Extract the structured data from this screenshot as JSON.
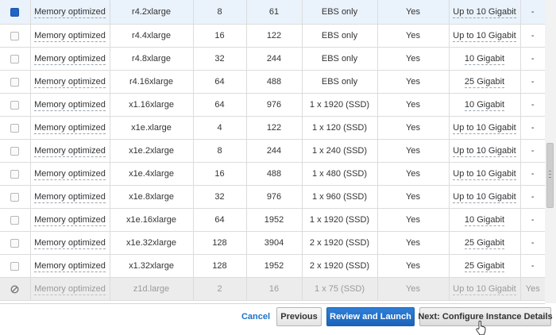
{
  "instance_table": {
    "rows": [
      {
        "state": "checked",
        "family": "Memory optimized",
        "type": "r4.2xlarge",
        "vcpus": "8",
        "memory": "61",
        "storage": "EBS only",
        "ebs_optimized": "Yes",
        "network": "Up to 10 Gigabit",
        "ipv6": "-"
      },
      {
        "state": "unchecked",
        "family": "Memory optimized",
        "type": "r4.4xlarge",
        "vcpus": "16",
        "memory": "122",
        "storage": "EBS only",
        "ebs_optimized": "Yes",
        "network": "Up to 10 Gigabit",
        "ipv6": "-"
      },
      {
        "state": "unchecked",
        "family": "Memory optimized",
        "type": "r4.8xlarge",
        "vcpus": "32",
        "memory": "244",
        "storage": "EBS only",
        "ebs_optimized": "Yes",
        "network": "10 Gigabit",
        "ipv6": "-"
      },
      {
        "state": "unchecked",
        "family": "Memory optimized",
        "type": "r4.16xlarge",
        "vcpus": "64",
        "memory": "488",
        "storage": "EBS only",
        "ebs_optimized": "Yes",
        "network": "25 Gigabit",
        "ipv6": "-"
      },
      {
        "state": "unchecked",
        "family": "Memory optimized",
        "type": "x1.16xlarge",
        "vcpus": "64",
        "memory": "976",
        "storage": "1 x 1920 (SSD)",
        "ebs_optimized": "Yes",
        "network": "10 Gigabit",
        "ipv6": "-"
      },
      {
        "state": "unchecked",
        "family": "Memory optimized",
        "type": "x1e.xlarge",
        "vcpus": "4",
        "memory": "122",
        "storage": "1 x 120 (SSD)",
        "ebs_optimized": "Yes",
        "network": "Up to 10 Gigabit",
        "ipv6": "-"
      },
      {
        "state": "unchecked",
        "family": "Memory optimized",
        "type": "x1e.2xlarge",
        "vcpus": "8",
        "memory": "244",
        "storage": "1 x 240 (SSD)",
        "ebs_optimized": "Yes",
        "network": "Up to 10 Gigabit",
        "ipv6": "-"
      },
      {
        "state": "unchecked",
        "family": "Memory optimized",
        "type": "x1e.4xlarge",
        "vcpus": "16",
        "memory": "488",
        "storage": "1 x 480 (SSD)",
        "ebs_optimized": "Yes",
        "network": "Up to 10 Gigabit",
        "ipv6": "-"
      },
      {
        "state": "unchecked",
        "family": "Memory optimized",
        "type": "x1e.8xlarge",
        "vcpus": "32",
        "memory": "976",
        "storage": "1 x 960 (SSD)",
        "ebs_optimized": "Yes",
        "network": "Up to 10 Gigabit",
        "ipv6": "-"
      },
      {
        "state": "unchecked",
        "family": "Memory optimized",
        "type": "x1e.16xlarge",
        "vcpus": "64",
        "memory": "1952",
        "storage": "1 x 1920 (SSD)",
        "ebs_optimized": "Yes",
        "network": "10 Gigabit",
        "ipv6": "-"
      },
      {
        "state": "unchecked",
        "family": "Memory optimized",
        "type": "x1e.32xlarge",
        "vcpus": "128",
        "memory": "3904",
        "storage": "2 x 1920 (SSD)",
        "ebs_optimized": "Yes",
        "network": "25 Gigabit",
        "ipv6": "-"
      },
      {
        "state": "unchecked",
        "family": "Memory optimized",
        "type": "x1.32xlarge",
        "vcpus": "128",
        "memory": "1952",
        "storage": "2 x 1920 (SSD)",
        "ebs_optimized": "Yes",
        "network": "25 Gigabit",
        "ipv6": "-"
      },
      {
        "state": "unavailable",
        "family": "Memory optimized",
        "type": "z1d.large",
        "vcpus": "2",
        "memory": "16",
        "storage": "1 x 75 (SSD)",
        "ebs_optimized": "Yes",
        "network": "Up to 10 Gigabit",
        "ipv6": "Yes"
      }
    ]
  },
  "footer": {
    "cancel_label": "Cancel",
    "previous_label": "Previous",
    "review_label": "Review and Launch",
    "next_label": "Next: Configure Instance Details"
  },
  "colors": {
    "primary_button": "#1b63b8",
    "link": "#1a73c9",
    "checkbox_selected": "#1f64c6",
    "selected_row": "#eaf2fb",
    "disabled_row": "#ececec"
  }
}
